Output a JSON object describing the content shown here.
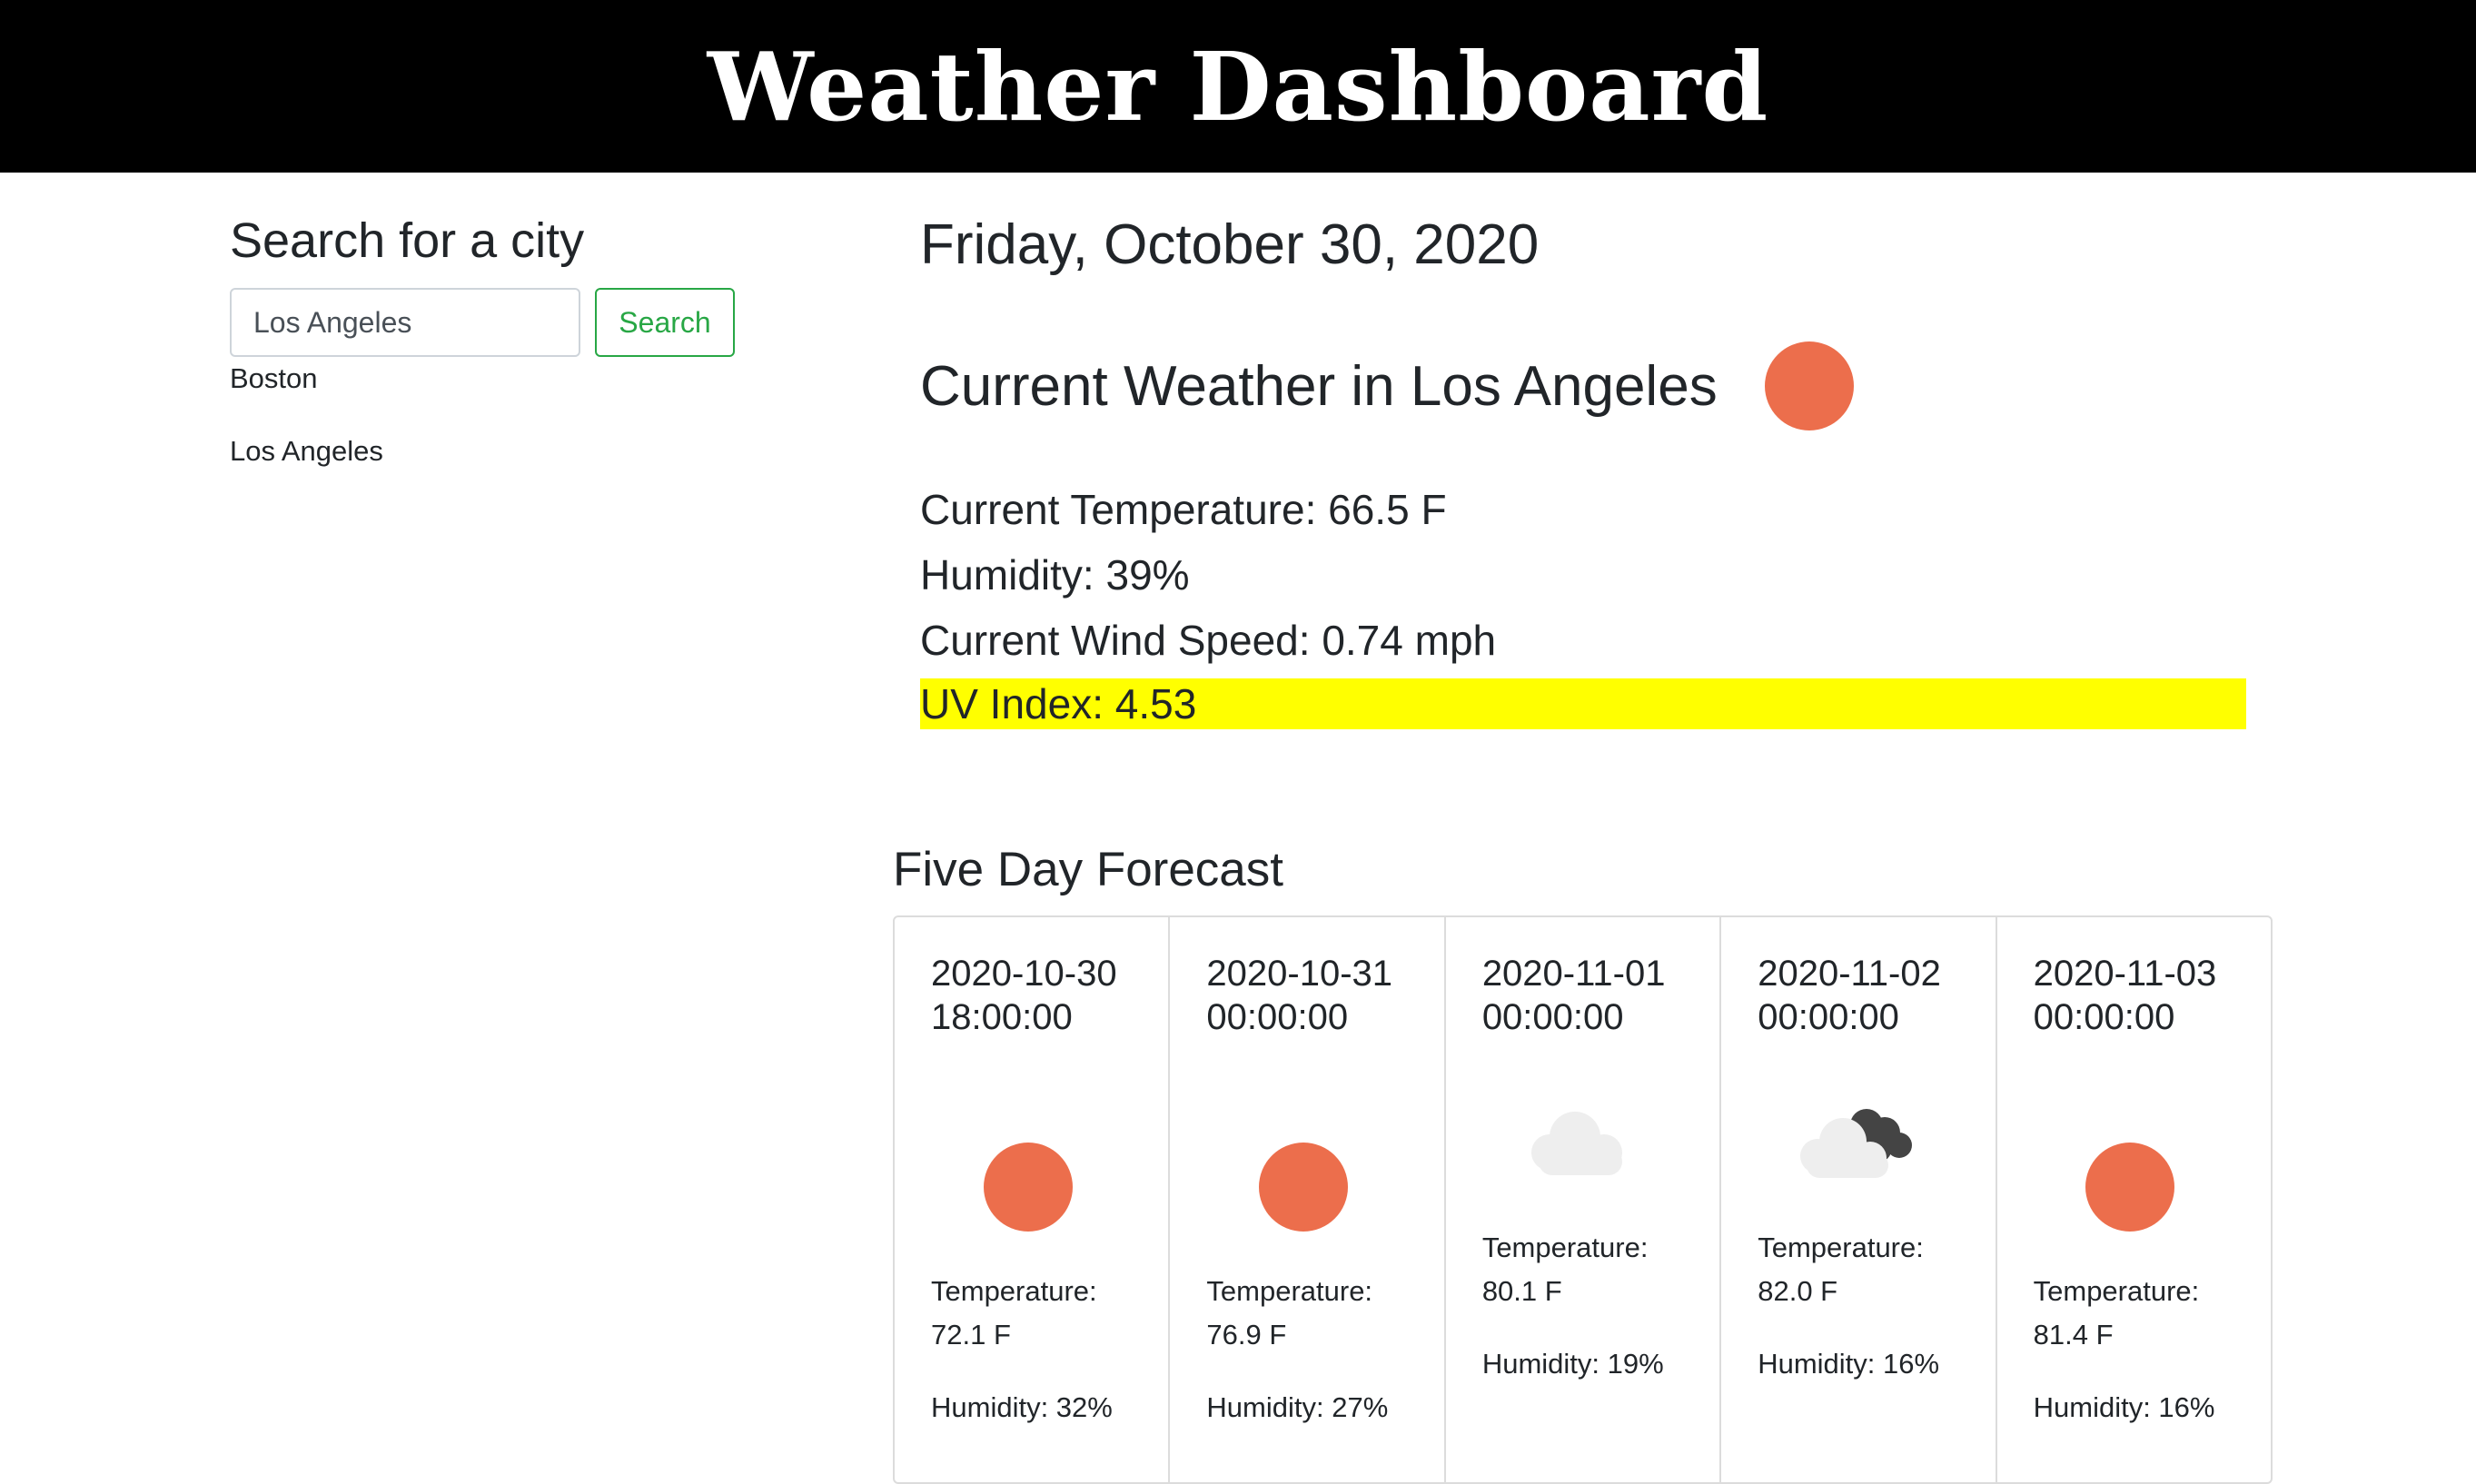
{
  "header": {
    "title": "Weather Dashboard"
  },
  "search": {
    "heading": "Search for a city",
    "input_value": "Los Angeles",
    "button_label": "Search",
    "history": [
      "Boston",
      "Los Angeles"
    ]
  },
  "current": {
    "date": "Friday, October 30, 2020",
    "title": "Current Weather in Los Angeles",
    "icon": "sun-icon",
    "temperature": "Current Temperature: 66.5 F",
    "humidity": "Humidity: 39%",
    "wind": "Current Wind Speed: 0.74 mph",
    "uv": "UV Index: 4.53",
    "uv_color": "#ffff00"
  },
  "forecast": {
    "heading": "Five Day Forecast",
    "days": [
      {
        "date": "2020-10-30 18:00:00",
        "icon": "sun-icon",
        "temperature_label": "Temperature:",
        "temperature": "72.1 F",
        "humidity": "Humidity: 32%"
      },
      {
        "date": "2020-10-31 00:00:00",
        "icon": "sun-icon",
        "temperature_label": "Temperature:",
        "temperature": "76.9 F",
        "humidity": "Humidity: 27%"
      },
      {
        "date": "2020-11-01 00:00:00",
        "icon": "cloud-icon",
        "temperature_label": "Temperature:",
        "temperature": "80.1 F",
        "humidity": "Humidity: 19%"
      },
      {
        "date": "2020-11-02 00:00:00",
        "icon": "broken-clouds-icon",
        "temperature_label": "Temperature:",
        "temperature": "82.0 F",
        "humidity": "Humidity: 16%"
      },
      {
        "date": "2020-11-03 00:00:00",
        "icon": "sun-icon",
        "temperature_label": "Temperature:",
        "temperature": "81.4 F",
        "humidity": "Humidity: 16%"
      }
    ]
  },
  "colors": {
    "sun": "#ec6e4c",
    "cloud_light": "#eeeeee",
    "cloud_dark": "#444444",
    "search_button": "#28a745"
  }
}
